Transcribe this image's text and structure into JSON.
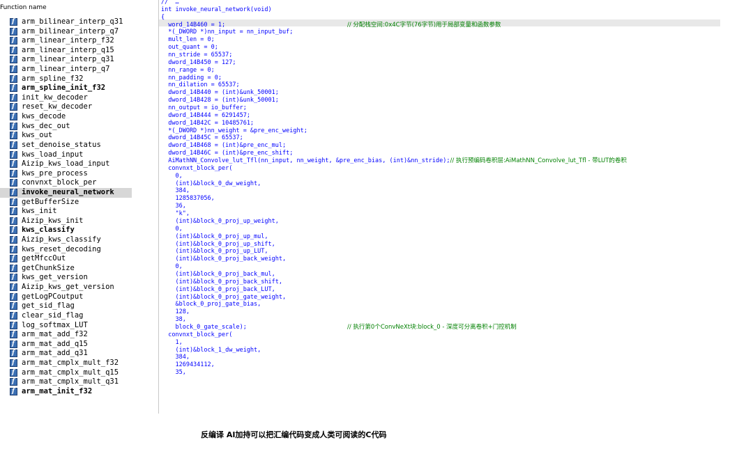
{
  "function_list": {
    "header": "Function name",
    "selected_index": 19,
    "items": [
      {
        "name": "arm_bilinear_interp_q31",
        "bold": false
      },
      {
        "name": "arm_bilinear_interp_q7",
        "bold": false
      },
      {
        "name": "arm_linear_interp_f32",
        "bold": false
      },
      {
        "name": "arm_linear_interp_q15",
        "bold": false
      },
      {
        "name": "arm_linear_interp_q31",
        "bold": false
      },
      {
        "name": "arm_linear_interp_q7",
        "bold": false
      },
      {
        "name": "arm_spline_f32",
        "bold": false
      },
      {
        "name": "arm_spline_init_f32",
        "bold": true
      },
      {
        "name": "init_kw_decoder",
        "bold": false
      },
      {
        "name": "reset_kw_decoder",
        "bold": false
      },
      {
        "name": "kws_decode",
        "bold": false
      },
      {
        "name": "kws_dec_out",
        "bold": false
      },
      {
        "name": "kws_out",
        "bold": false
      },
      {
        "name": "set_denoise_status",
        "bold": false
      },
      {
        "name": "kws_load_input",
        "bold": false
      },
      {
        "name": "Aizip_kws_load_input",
        "bold": false
      },
      {
        "name": "kws_pre_process",
        "bold": false
      },
      {
        "name": "convnxt_block_per",
        "bold": false
      },
      {
        "name": "invoke_neural_network",
        "bold": true
      },
      {
        "name": "getBufferSize",
        "bold": false
      },
      {
        "name": "kws_init",
        "bold": false
      },
      {
        "name": "Aizip_kws_init",
        "bold": false
      },
      {
        "name": "kws_classify",
        "bold": true
      },
      {
        "name": "Aizip_kws_classify",
        "bold": false
      },
      {
        "name": "kws_reset_decoding",
        "bold": false
      },
      {
        "name": "getMfccOut",
        "bold": false
      },
      {
        "name": "getChunkSize",
        "bold": false
      },
      {
        "name": "kws_get_version",
        "bold": false
      },
      {
        "name": "Aizip_kws_get_version",
        "bold": false
      },
      {
        "name": "getLogPCoutput",
        "bold": false
      },
      {
        "name": "get_sid_flag",
        "bold": false
      },
      {
        "name": "clear_sid_flag",
        "bold": false
      },
      {
        "name": "log_softmax_LUT",
        "bold": false
      },
      {
        "name": "arm_mat_add_f32",
        "bold": false
      },
      {
        "name": "arm_mat_add_q15",
        "bold": false
      },
      {
        "name": "arm_mat_add_q31",
        "bold": false
      },
      {
        "name": "arm_mat_cmplx_mult_f32",
        "bold": false
      },
      {
        "name": "arm_mat_cmplx_mult_q15",
        "bold": false
      },
      {
        "name": "arm_mat_cmplx_mult_q31",
        "bold": false
      },
      {
        "name": "arm_mat_init_f32",
        "bold": true
      }
    ]
  },
  "code": {
    "lines": [
      {
        "text": "//  …",
        "comment": ""
      },
      {
        "text": "int invoke_neural_network(void)",
        "comment": ""
      },
      {
        "text": "{",
        "comment": ""
      },
      {
        "text": "  word_14B460 = 1;",
        "comment": "// 分配栈空间:0x4C字节(76字节)用于局部变量和函数参数"
      },
      {
        "text": "  *(_DWORD *)nn_input = nn_input_buf;",
        "comment": ""
      },
      {
        "text": "  mult_len = 0;",
        "comment": ""
      },
      {
        "text": "  out_quant = 0;",
        "comment": ""
      },
      {
        "text": "  nn_stride = 65537;",
        "comment": ""
      },
      {
        "text": "  dword_14B450 = 127;",
        "comment": ""
      },
      {
        "text": "  nn_range = 0;",
        "comment": ""
      },
      {
        "text": "  nn_padding = 0;",
        "comment": ""
      },
      {
        "text": "  nn_dilation = 65537;",
        "comment": ""
      },
      {
        "text": "  dword_14B440 = (int)&unk_50001;",
        "comment": ""
      },
      {
        "text": "  dword_14B428 = (int)&unk_50001;",
        "comment": ""
      },
      {
        "text": "  nn_output = io_buffer;",
        "comment": ""
      },
      {
        "text": "  dword_14B444 = 6291457;",
        "comment": ""
      },
      {
        "text": "  dword_14B42C = 10485761;",
        "comment": ""
      },
      {
        "text": "  *(_DWORD *)nn_weight = &pre_enc_weight;",
        "comment": ""
      },
      {
        "text": "  dword_14B45C = 65537;",
        "comment": ""
      },
      {
        "text": "  dword_14B468 = (int)&pre_enc_mul;",
        "comment": ""
      },
      {
        "text": "  dword_14B46C = (int)&pre_enc_shift;",
        "comment": ""
      },
      {
        "text": "  AiMathNN_Convolve_lut_Tfl(nn_input, nn_weight, &pre_enc_bias, (int)&nn_stride);",
        "comment": "",
        "inline": "// 执行预编码卷积层:AiMathNN_Convolve_lut_Tfl - 带LUT的卷积"
      },
      {
        "text": "  convnxt_block_per(",
        "comment": ""
      },
      {
        "text": "    0,",
        "comment": ""
      },
      {
        "text": "    (int)&block_0_dw_weight,",
        "comment": ""
      },
      {
        "text": "    384,",
        "comment": ""
      },
      {
        "text": "    1285837056,",
        "comment": ""
      },
      {
        "text": "    36,",
        "comment": ""
      },
      {
        "text": "    \"k\",",
        "comment": ""
      },
      {
        "text": "    (int)&block_0_proj_up_weight,",
        "comment": ""
      },
      {
        "text": "    0,",
        "comment": ""
      },
      {
        "text": "    (int)&block_0_proj_up_mul,",
        "comment": ""
      },
      {
        "text": "    (int)&block_0_proj_up_shift,",
        "comment": ""
      },
      {
        "text": "    (int)&block_0_proj_up_LUT,",
        "comment": ""
      },
      {
        "text": "    (int)&block_0_proj_back_weight,",
        "comment": ""
      },
      {
        "text": "    0,",
        "comment": ""
      },
      {
        "text": "    (int)&block_0_proj_back_mul,",
        "comment": ""
      },
      {
        "text": "    (int)&block_0_proj_back_shift,",
        "comment": ""
      },
      {
        "text": "    (int)&block_0_proj_back_LUT,",
        "comment": ""
      },
      {
        "text": "    (int)&block_0_proj_gate_weight,",
        "comment": ""
      },
      {
        "text": "    &block_0_proj_gate_bias,",
        "comment": ""
      },
      {
        "text": "    128,",
        "comment": ""
      },
      {
        "text": "    38,",
        "comment": ""
      },
      {
        "text": "    block_0_gate_scale);",
        "comment": "// 执行第0个ConvNeXt块:block_0 - 深度可分离卷积+门控机制"
      },
      {
        "text": "  convnxt_block_per(",
        "comment": ""
      },
      {
        "text": "    1,",
        "comment": ""
      },
      {
        "text": "    (int)&block_1_dw_weight,",
        "comment": ""
      },
      {
        "text": "    384,",
        "comment": ""
      },
      {
        "text": "    1269434112,",
        "comment": ""
      },
      {
        "text": "    35,",
        "comment": ""
      }
    ]
  },
  "caption": "反编译 AI加持可以把汇编代码变成人类可阅读的C代码",
  "colors": {
    "code": "#0000ff",
    "comment": "#008000",
    "selection": "#d7d7d7",
    "icon": "#3b6fb3"
  }
}
